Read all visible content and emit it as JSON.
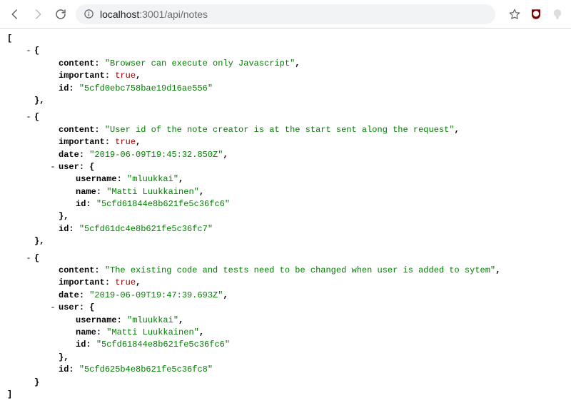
{
  "browser": {
    "url_host": "localhost",
    "url_port": ":3001",
    "url_path": "/api/notes"
  },
  "toggle": {
    "minus": "-"
  },
  "json": {
    "bo": "[",
    "bc": "]",
    "oo": "{",
    "oc1": "},",
    "oc2": "}",
    "k": {
      "content": "content",
      "important": "important",
      "id": "id",
      "date": "date",
      "user": "user",
      "username": "username",
      "name": "name"
    },
    "colon": ": ",
    "comma": ",",
    "q": "\"",
    "v": {
      "true": "true"
    },
    "n0": {
      "content": "Browser can execute only Javascript",
      "id": "5cfd0ebc758bae19d16ae556"
    },
    "n1": {
      "content": "User id of the note creator is at the start sent along the request",
      "date": "2019-06-09T19:45:32.850Z",
      "id": "5cfd61dc4e8b621fe5c36fc7",
      "user": {
        "username": "mluukkai",
        "name": "Matti Luukkainen",
        "id": "5cfd61844e8b621fe5c36fc6"
      }
    },
    "n2": {
      "content": "The existing code and tests need to be changed when user is added to sytem",
      "date": "2019-06-09T19:47:39.693Z",
      "id": "5cfd625b4e8b621fe5c36fc8",
      "user": {
        "username": "mluukkai",
        "name": "Matti Luukkainen",
        "id": "5cfd61844e8b621fe5c36fc6"
      }
    }
  }
}
